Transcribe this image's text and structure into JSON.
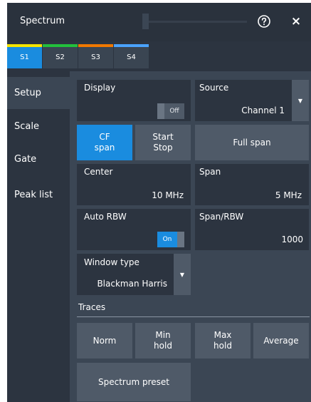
{
  "window": {
    "title": "Spectrum",
    "help_icon": "help-circle-icon",
    "close_icon": "close-icon",
    "close_glyph": "×"
  },
  "tabs": [
    {
      "label": "S1",
      "color": "#f5e400",
      "active": true
    },
    {
      "label": "S2",
      "color": "#22c03c",
      "active": false
    },
    {
      "label": "S3",
      "color": "#f07800",
      "active": false
    },
    {
      "label": "S4",
      "color": "#4aa3ff",
      "active": false
    }
  ],
  "sidebar": {
    "items": [
      {
        "label": "Setup",
        "active": true
      },
      {
        "label": "Scale",
        "active": false
      },
      {
        "label": "Gate",
        "active": false
      },
      {
        "label": "Peak list",
        "active": false
      }
    ]
  },
  "setup": {
    "display": {
      "label": "Display",
      "toggle": "Off"
    },
    "source": {
      "label": "Source",
      "value": "Channel 1"
    },
    "cf_span": {
      "line1": "CF",
      "line2": "span"
    },
    "start_stop": {
      "line1": "Start",
      "line2": "Stop"
    },
    "full_span": "Full span",
    "center": {
      "label": "Center",
      "value": "10 MHz"
    },
    "span": {
      "label": "Span",
      "value": "5 MHz"
    },
    "auto_rbw": {
      "label": "Auto RBW",
      "toggle": "On"
    },
    "span_rbw": {
      "label": "Span/RBW",
      "value": "1000"
    },
    "window_type": {
      "label": "Window type",
      "value": "Blackman Harris"
    },
    "traces": {
      "label": "Traces",
      "norm": "Norm",
      "min_hold": {
        "line1": "Min",
        "line2": "hold"
      },
      "max_hold": {
        "line1": "Max",
        "line2": "hold"
      },
      "average": "Average"
    },
    "spectrum_preset": "Spectrum preset"
  },
  "colors": {
    "accent": "#1a8cdf",
    "panel_dark": "#2c3440",
    "panel_mid": "#3b4654",
    "button": "#4f5a68"
  }
}
